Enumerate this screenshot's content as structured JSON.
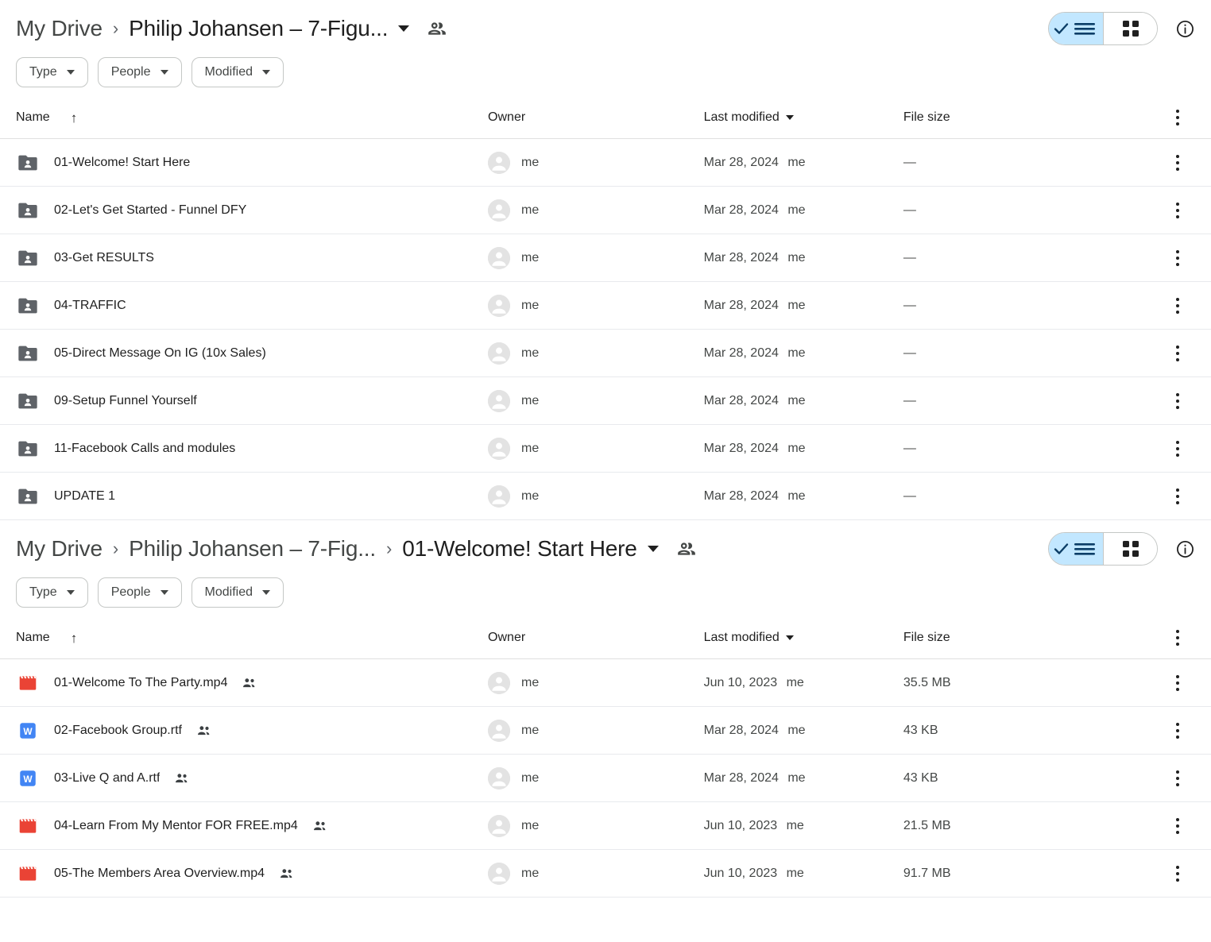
{
  "panes": [
    {
      "id": "folder-listing",
      "breadcrumb": [
        {
          "label": "My Drive",
          "current": false
        },
        {
          "label": "Philip Johansen – 7-Figu...",
          "current": true
        }
      ],
      "share_icon": "people-share-icon",
      "view_toggle": {
        "list_label": "list-view",
        "grid_label": "grid-view",
        "active": "list"
      },
      "info_icon": "info-icon",
      "filters": [
        {
          "label": "Type"
        },
        {
          "label": "People"
        },
        {
          "label": "Modified"
        }
      ],
      "columns": {
        "name": "Name",
        "owner": "Owner",
        "modified": "Last modified",
        "size": "File size"
      },
      "sort": {
        "column": "Name",
        "direction": "ascending",
        "glyph": "↑"
      },
      "rows": [
        {
          "name": "01-Welcome! Start Here",
          "icon": "shared-folder-icon",
          "shared": false,
          "owner": "me",
          "modified": "Mar 28, 2024",
          "modified_by": "me",
          "size": "—"
        },
        {
          "name": "02-Let's Get Started - Funnel DFY",
          "icon": "shared-folder-icon",
          "shared": false,
          "owner": "me",
          "modified": "Mar 28, 2024",
          "modified_by": "me",
          "size": "—"
        },
        {
          "name": "03-Get RESULTS",
          "icon": "shared-folder-icon",
          "shared": false,
          "owner": "me",
          "modified": "Mar 28, 2024",
          "modified_by": "me",
          "size": "—"
        },
        {
          "name": "04-TRAFFIC",
          "icon": "shared-folder-icon",
          "shared": false,
          "owner": "me",
          "modified": "Mar 28, 2024",
          "modified_by": "me",
          "size": "—"
        },
        {
          "name": "05-Direct Message On IG (10x Sales)",
          "icon": "shared-folder-icon",
          "shared": false,
          "owner": "me",
          "modified": "Mar 28, 2024",
          "modified_by": "me",
          "size": "—"
        },
        {
          "name": "09-Setup Funnel Yourself",
          "icon": "shared-folder-icon",
          "shared": false,
          "owner": "me",
          "modified": "Mar 28, 2024",
          "modified_by": "me",
          "size": "—"
        },
        {
          "name": "11-Facebook Calls and modules",
          "icon": "shared-folder-icon",
          "shared": false,
          "owner": "me",
          "modified": "Mar 28, 2024",
          "modified_by": "me",
          "size": "—"
        },
        {
          "name": "UPDATE 1",
          "icon": "shared-folder-icon",
          "shared": false,
          "owner": "me",
          "modified": "Mar 28, 2024",
          "modified_by": "me",
          "size": "—"
        }
      ]
    },
    {
      "id": "file-listing",
      "breadcrumb": [
        {
          "label": "My Drive",
          "current": false
        },
        {
          "label": "Philip Johansen – 7-Fig...",
          "current": false
        },
        {
          "label": "01-Welcome! Start Here",
          "current": true
        }
      ],
      "share_icon": "people-share-icon",
      "view_toggle": {
        "list_label": "list-view",
        "grid_label": "grid-view",
        "active": "list"
      },
      "info_icon": "info-icon",
      "filters": [
        {
          "label": "Type"
        },
        {
          "label": "People"
        },
        {
          "label": "Modified"
        }
      ],
      "columns": {
        "name": "Name",
        "owner": "Owner",
        "modified": "Last modified",
        "size": "File size"
      },
      "sort": {
        "column": "Name",
        "direction": "ascending",
        "glyph": "↑"
      },
      "rows": [
        {
          "name": "01-Welcome To The Party.mp4",
          "icon": "video-file-icon",
          "shared": true,
          "owner": "me",
          "modified": "Jun 10, 2023",
          "modified_by": "me",
          "size": "35.5 MB"
        },
        {
          "name": "02-Facebook Group.rtf",
          "icon": "word-document-icon",
          "shared": true,
          "owner": "me",
          "modified": "Mar 28, 2024",
          "modified_by": "me",
          "size": "43 KB"
        },
        {
          "name": "03-Live Q and A.rtf",
          "icon": "word-document-icon",
          "shared": true,
          "owner": "me",
          "modified": "Mar 28, 2024",
          "modified_by": "me",
          "size": "43 KB"
        },
        {
          "name": "04-Learn From My Mentor FOR FREE.mp4",
          "icon": "video-file-icon",
          "shared": true,
          "owner": "me",
          "modified": "Jun 10, 2023",
          "modified_by": "me",
          "size": "21.5 MB"
        },
        {
          "name": "05-The Members Area Overview.mp4",
          "icon": "video-file-icon",
          "shared": true,
          "owner": "me",
          "modified": "Jun 10, 2023",
          "modified_by": "me",
          "size": "91.7 MB"
        }
      ]
    }
  ],
  "colors": {
    "accent_active": "#c2e7ff",
    "video_icon": "#ea4335",
    "word_icon": "#4285f4",
    "folder_icon": "#5f6368",
    "text_primary": "#1f1f1f",
    "text_secondary": "#444746",
    "border": "#c4c7c5",
    "row_divider": "#e8eaed"
  }
}
